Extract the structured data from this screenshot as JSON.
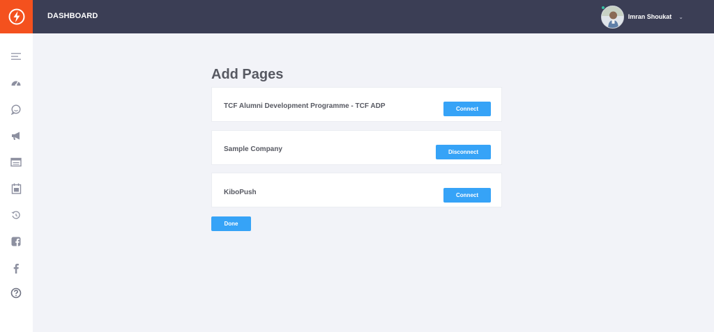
{
  "header": {
    "title": "DASHBOARD",
    "user_name": "Imran Shoukat",
    "user_chevron": "⌄"
  },
  "sidebar": {
    "items": [
      {
        "icon": "toggle-menu-icon"
      },
      {
        "icon": "dashboard-gauge-icon"
      },
      {
        "icon": "chat-bubble-icon"
      },
      {
        "icon": "megaphone-icon"
      },
      {
        "icon": "browser-window-icon"
      },
      {
        "icon": "calendar-icon"
      },
      {
        "icon": "history-icon"
      },
      {
        "icon": "facebook-square-icon"
      },
      {
        "icon": "facebook-icon"
      },
      {
        "icon": "help-icon"
      }
    ]
  },
  "main": {
    "heading": "Add Pages",
    "pages": [
      {
        "name": "TCF Alumni Development Programme - TCF ADP",
        "action": "Connect"
      },
      {
        "name": "Sample Company",
        "action": "Disconnect"
      },
      {
        "name": "KiboPush",
        "action": "Connect"
      }
    ],
    "done_label": "Done"
  },
  "colors": {
    "accent": "#36a3f7",
    "brand": "#f4511e",
    "header_bg": "#3b3e55",
    "page_bg": "#f2f3f8"
  }
}
